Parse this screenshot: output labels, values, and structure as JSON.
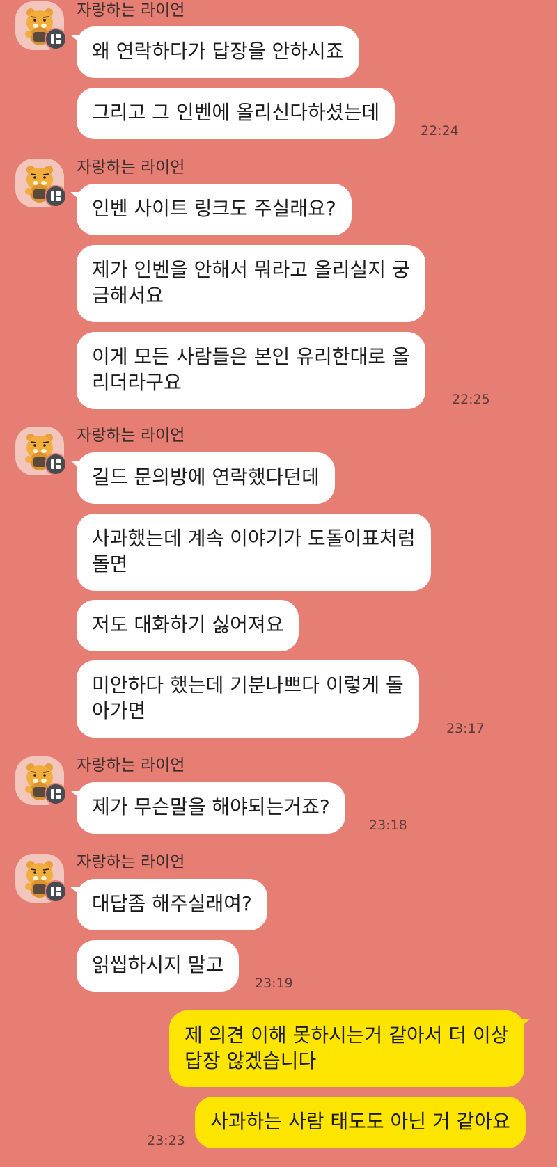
{
  "groups": [
    {
      "sender": "자랑하는 라이언",
      "messages": [
        "왜 연락하다가 답장을 안하시죠",
        "그리고 그 인벤에 올리신다하셨는데"
      ],
      "time": "22:24"
    },
    {
      "sender": "자랑하는 라이언",
      "messages": [
        "인벤 사이트 링크도 주실래요?",
        "제가 인벤을 안해서 뭐라고 올리실지 궁\n금해서요",
        "이게 모든 사람들은 본인 유리한대로 올\n리더라구요"
      ],
      "time": "22:25"
    },
    {
      "sender": "자랑하는 라이언",
      "messages": [
        "길드 문의방에 연락했다던데",
        "사과했는데 계속 이야기가 도돌이표처럼\n돌면",
        "저도 대화하기 싫어져요",
        "미안하다 했는데 기분나쁘다 이렇게 돌\n아가면"
      ],
      "time": "23:17"
    },
    {
      "sender": "자랑하는 라이언",
      "messages": [
        "제가 무슨말을 해야되는거죠?"
      ],
      "time": "23:18"
    },
    {
      "sender": "자랑하는 라이언",
      "messages": [
        "대답좀 해주실래여?",
        "읽씹하시지 말고"
      ],
      "time": "23:19"
    }
  ],
  "my_messages": {
    "messages": [
      "제 의견 이해 못하시는거 같아서 더 이상\n답장 않겠습니다",
      "사과하는 사람 태도도 아닌 거 같아요"
    ],
    "time": "23:23"
  },
  "icons": {
    "avatar": "ryan-lion-avatar-icon",
    "badge": "profile-badge-icon"
  },
  "colors": {
    "background": "#e67e74",
    "received_bubble": "#ffffff",
    "sent_bubble": "#fee500"
  }
}
